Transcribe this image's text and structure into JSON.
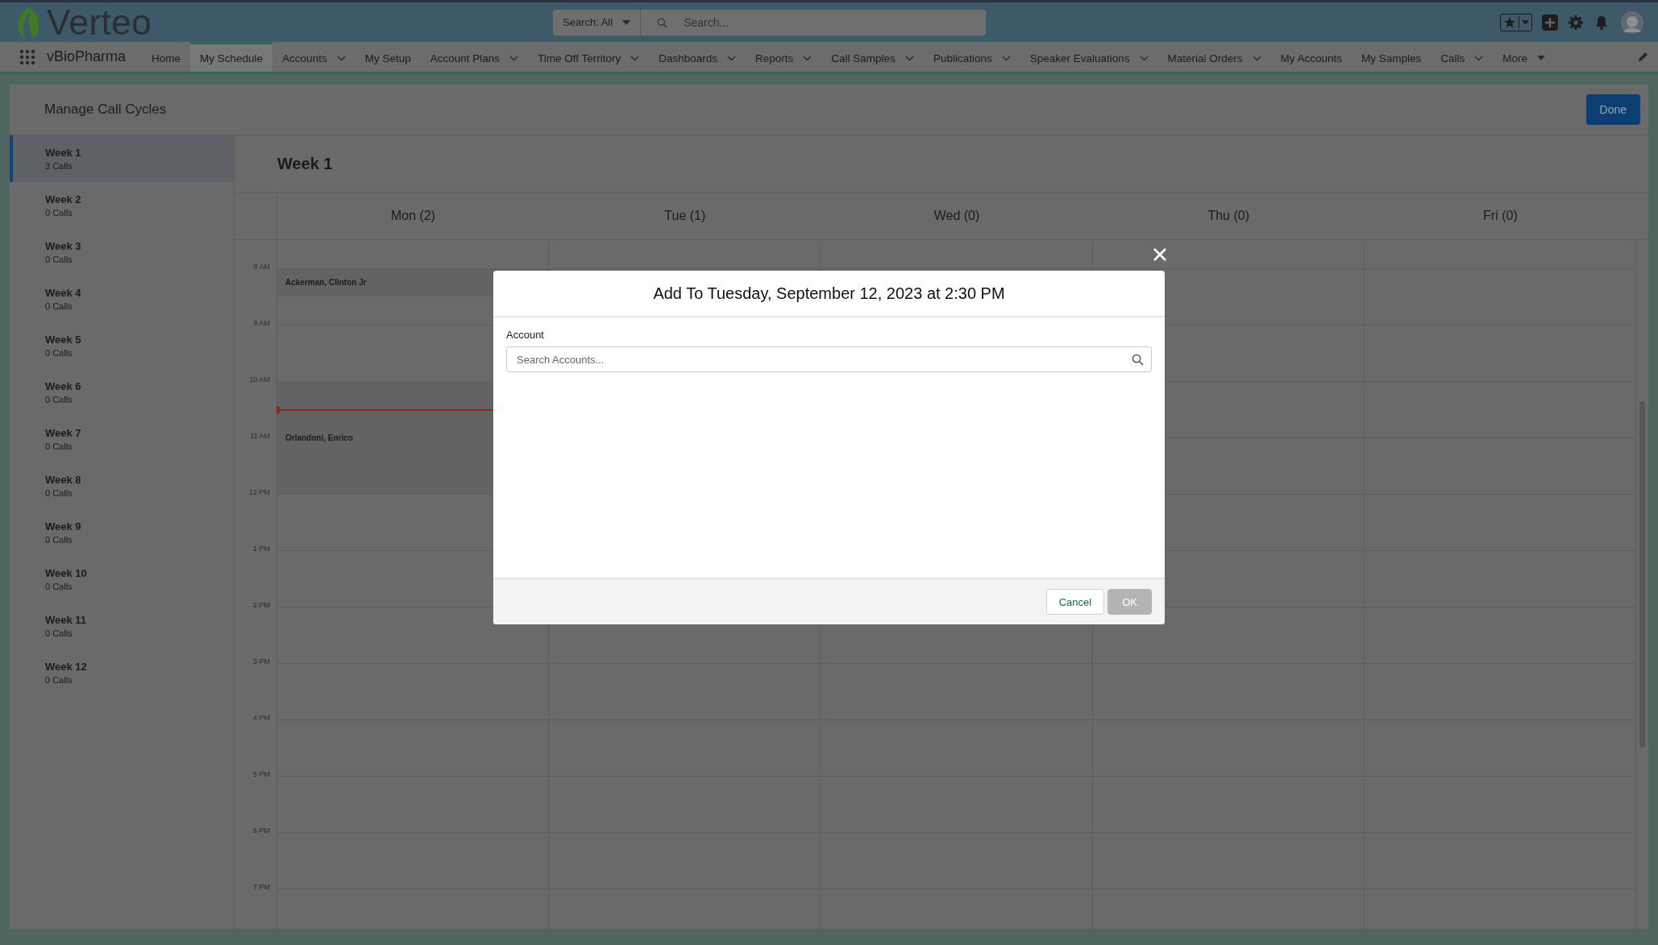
{
  "header": {
    "logo": "Verteo",
    "search_scope": "Search: All",
    "search_placeholder": "Search..."
  },
  "app_name": "vBioPharma",
  "nav": [
    {
      "label": "Home",
      "selected": false,
      "kind": "plain"
    },
    {
      "label": "My Schedule",
      "selected": true,
      "kind": "plain"
    },
    {
      "label": "Accounts",
      "selected": false,
      "kind": "menu"
    },
    {
      "label": "My Setup",
      "selected": false,
      "kind": "plain"
    },
    {
      "label": "Account Plans",
      "selected": false,
      "kind": "menu"
    },
    {
      "label": "Time Off Territory",
      "selected": false,
      "kind": "menu"
    },
    {
      "label": "Dashboards",
      "selected": false,
      "kind": "menu"
    },
    {
      "label": "Reports",
      "selected": false,
      "kind": "menu"
    },
    {
      "label": "Call Samples",
      "selected": false,
      "kind": "menu"
    },
    {
      "label": "Publications",
      "selected": false,
      "kind": "menu"
    },
    {
      "label": "Speaker Evaluations",
      "selected": false,
      "kind": "menu"
    },
    {
      "label": "Material Orders",
      "selected": false,
      "kind": "menu"
    },
    {
      "label": "My Accounts",
      "selected": false,
      "kind": "plain"
    },
    {
      "label": "My Samples",
      "selected": false,
      "kind": "plain"
    },
    {
      "label": "Calls",
      "selected": false,
      "kind": "menu"
    },
    {
      "label": "More",
      "selected": false,
      "kind": "more"
    }
  ],
  "page": {
    "title": "Manage Call Cycles",
    "done_button": "Done"
  },
  "weeks": [
    {
      "label": "Week 1",
      "calls": "3 Calls",
      "selected": true
    },
    {
      "label": "Week 2",
      "calls": "0 Calls",
      "selected": false
    },
    {
      "label": "Week 3",
      "calls": "0 Calls",
      "selected": false
    },
    {
      "label": "Week 4",
      "calls": "0 Calls",
      "selected": false
    },
    {
      "label": "Week 5",
      "calls": "0 Calls",
      "selected": false
    },
    {
      "label": "Week 6",
      "calls": "0 Calls",
      "selected": false
    },
    {
      "label": "Week 7",
      "calls": "0 Calls",
      "selected": false
    },
    {
      "label": "Week 8",
      "calls": "0 Calls",
      "selected": false
    },
    {
      "label": "Week 9",
      "calls": "0 Calls",
      "selected": false
    },
    {
      "label": "Week 10",
      "calls": "0 Calls",
      "selected": false
    },
    {
      "label": "Week 11",
      "calls": "0 Calls",
      "selected": false
    },
    {
      "label": "Week 12",
      "calls": "0 Calls",
      "selected": false
    }
  ],
  "calendar": {
    "title": "Week 1",
    "hours": [
      "8 AM",
      "9 AM",
      "10 AM",
      "11 AM",
      "12 PM",
      "1 PM",
      "2 PM",
      "3 PM",
      "4 PM",
      "5 PM",
      "6 PM",
      "7 PM"
    ],
    "days": [
      {
        "label": "Mon (2)",
        "events": [
          {
            "name": "Ackerman, Clinton Jr"
          },
          {
            "name": "Orlandoni, Enrico"
          }
        ]
      },
      {
        "label": "Tue (1)"
      },
      {
        "label": "Wed (0)"
      },
      {
        "label": "Thu (0)"
      },
      {
        "label": "Fri (0)"
      }
    ]
  },
  "dialog": {
    "title": "Add To Tuesday, September 12, 2023 at 2:30 PM",
    "field_label": "Account",
    "placeholder": "Search Accounts...",
    "cancel_button": "Cancel",
    "ok_button": {
      "label": "OK",
      "disabled": true
    }
  }
}
